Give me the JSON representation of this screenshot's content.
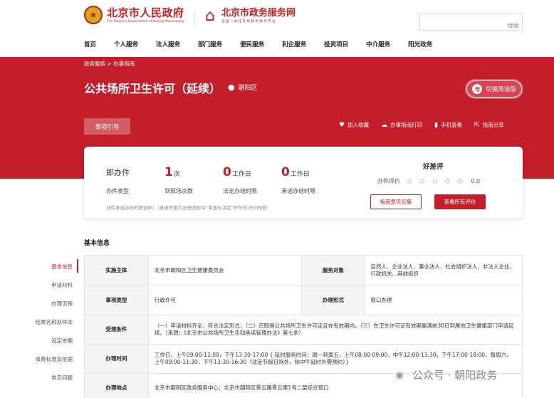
{
  "header": {
    "gov_name": "北京市人民政府",
    "gov_name_en": "The People's Government of Beijing Municipality",
    "service_name": "北京市政务服务网",
    "service_slogan": "全 国 一 体 化 在 线 政 务 服 务 平 台",
    "search_button": "搜索",
    "search_value": ""
  },
  "nav": [
    "首页",
    "个人服务",
    "法人服务",
    "部门服务",
    "便民服务",
    "利企服务",
    "投资项目",
    "中介服务",
    "阳光政务"
  ],
  "breadcrumb": {
    "item1": "政务服务",
    "separator": ">",
    "item2": "办事指南"
  },
  "page": {
    "title": "公共场所卫生许可（延续）",
    "region": "朝阳区",
    "switch_label": "切换简洁版",
    "guide_tab": "事项引导"
  },
  "actions": [
    {
      "icon": "heart-icon",
      "glyph": "♥",
      "label": "加入收藏"
    },
    {
      "icon": "cloud-print-icon",
      "glyph": "☁",
      "label": "办事指南打印"
    },
    {
      "icon": "phone-icon",
      "glyph": "▮",
      "label": "手机查看"
    },
    {
      "icon": "share-icon",
      "glyph": "⇱",
      "label": "指南分享"
    }
  ],
  "stats": {
    "type_value": "即办件",
    "type_label": "办件类型",
    "visits_value": "1",
    "visits_unit": "次",
    "visits_label": "到现场次数",
    "legal_value": "0",
    "legal_unit": "工作日",
    "legal_label": "法定办结时限",
    "promise_value": "0",
    "promise_unit": "工作日",
    "promise_label": "承诺办结时限",
    "note": "办件承诺办结时限说明：（承诺时限为办理流程中“审查与决定”环节的计时时限）"
  },
  "rating": {
    "title": "好差评",
    "label": "办件评价",
    "score": "0.0",
    "stars": 0,
    "feedback_button": "指南意见征集",
    "view_all_button": "查看所有评价"
  },
  "section_title": "基本信息",
  "sidenav": [
    "基本信息",
    "申请材料",
    "办理流程",
    "结果名称及样本",
    "设定依据",
    "收费标准及依据",
    "常见问题"
  ],
  "basic_info": {
    "subject_label": "实施主体",
    "subject_value": "北京市朝阳区卫生健康委员会",
    "target_label": "服务对象",
    "target_value": "自然人、企业法人、事业法人、社会组织法人、非法人企业、行政机关、其他组织",
    "type_label": "事项类型",
    "type_value": "行政许可",
    "form_label": "办理形式",
    "form_value": "窗口办理",
    "condition_label": "受理条件",
    "condition_value": "（一）申请材料齐全，符合法定形式；（二）已取得公共场所卫生许可证且在有效期内。（三）在卫生许可证有效期届满前30日到属地卫生健康部门申请延续。（来源：《北京市公共场所卫生告知承诺管理办法》第七条）",
    "time_label": "办理时间",
    "time_value": "工作日，上午09:00-12:00，下午13:30-17:00 { 延时服务时间：周一到周五，上午08:00-09:00，中午12:00-13:30，下午17:00-18:00，每周六，上午09:00-11:30，下午13:30-16:30（法定节假日除外，除中午延时外需预约）}",
    "place_label": "办理地点",
    "place_value": "北京市朝阳区政务服务中心：北京市朝阳区霄云路霄云里1号二层综合窗口"
  },
  "watermark": "公众号 · 朝阳政务"
}
